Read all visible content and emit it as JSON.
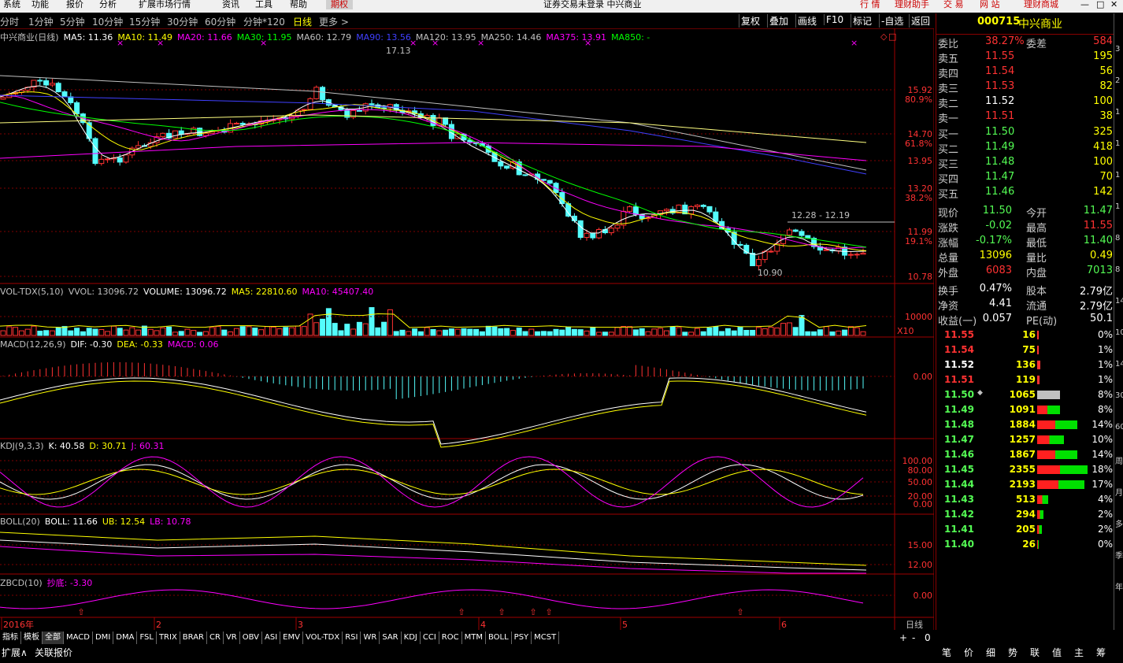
{
  "menubar": {
    "items": [
      "系统",
      "功能",
      "报价",
      "分析",
      "扩展市场行情",
      "资讯",
      "工具",
      "帮助"
    ],
    "active_tab": "期权",
    "title": "证券交易未登录  中兴商业",
    "right_buttons": [
      "行 情",
      "理财助手",
      "交 易",
      "网 站",
      "理财商城"
    ]
  },
  "periods": {
    "items": [
      "分时",
      "1分钟",
      "5分钟",
      "10分钟",
      "15分钟",
      "30分钟",
      "60分钟",
      "分钟*120",
      "日线",
      "更多 >"
    ],
    "active": "日线"
  },
  "toolbar": {
    "items": [
      "复权",
      "叠加",
      "画线",
      "F10",
      "标记",
      "-自选",
      "返回"
    ]
  },
  "main_legend": [
    {
      "text": "中兴商业(日线)",
      "color": "#c0c0c0"
    },
    {
      "text": "MA5: 11.36",
      "color": "#ffffff"
    },
    {
      "text": "MA10: 11.49",
      "color": "#ffff00"
    },
    {
      "text": "MA20: 11.66",
      "color": "#ff00ff"
    },
    {
      "text": "MA30: 11.95",
      "color": "#00ff00"
    },
    {
      "text": "MA60: 12.79",
      "color": "#c0c0c0"
    },
    {
      "text": "MA90: 13.56",
      "color": "#4040ff"
    },
    {
      "text": "MA120: 13.95",
      "color": "#c0c0c0"
    },
    {
      "text": "MA250: 14.46",
      "color": "#c0c0c0"
    },
    {
      "text": "MA375: 13.91",
      "color": "#ff00ff"
    },
    {
      "text": "MA850: -",
      "color": "#00ff00"
    }
  ],
  "price_axis": [
    {
      "v": "15.92",
      "p": "80.9%"
    },
    {
      "v": "14.70",
      "p": "61.8%"
    },
    {
      "v": "13.95",
      "p": ""
    },
    {
      "v": "13.20",
      "p": "38.2%"
    },
    {
      "v": "11.99",
      "p": "19.1%"
    },
    {
      "v": "10.78",
      "p": ""
    }
  ],
  "annotations": {
    "high": "17.13",
    "low": "10.90",
    "range": "12.28 - 12.19"
  },
  "vol_legend": [
    {
      "text": "VOL-TDX(5,10)",
      "color": "#c0c0c0"
    },
    {
      "text": "VVOL: 13096.72",
      "color": "#c0c0c0"
    },
    {
      "text": "VOLUME: 13096.72",
      "color": "#ffffff"
    },
    {
      "text": "MA5: 22810.60",
      "color": "#ffff00"
    },
    {
      "text": "MA10: 45407.40",
      "color": "#ff00ff"
    }
  ],
  "vol_axis": [
    "10000",
    "X10"
  ],
  "macd_legend": [
    {
      "text": "MACD(12,26,9)",
      "color": "#c0c0c0"
    },
    {
      "text": "DIF: -0.30",
      "color": "#ffffff"
    },
    {
      "text": "DEA: -0.33",
      "color": "#ffff00"
    },
    {
      "text": "MACD: 0.06",
      "color": "#ff00ff"
    }
  ],
  "macd_axis": [
    "0.00"
  ],
  "kdj_legend": [
    {
      "text": "KDJ(9,3,3)",
      "color": "#c0c0c0"
    },
    {
      "text": "K: 40.58",
      "color": "#ffffff"
    },
    {
      "text": "D: 30.71",
      "color": "#ffff00"
    },
    {
      "text": "J: 60.31",
      "color": "#ff00ff"
    }
  ],
  "kdj_axis": [
    "100.00",
    "80.00",
    "50.00",
    "20.00",
    "0.00"
  ],
  "boll_legend": [
    {
      "text": "BOLL(20)",
      "color": "#c0c0c0"
    },
    {
      "text": "BOLL: 11.66",
      "color": "#ffffff"
    },
    {
      "text": "UB: 12.54",
      "color": "#ffff00"
    },
    {
      "text": "LB: 10.78",
      "color": "#ff00ff"
    }
  ],
  "boll_axis": [
    "15.00",
    "12.00"
  ],
  "zbcd_legend": [
    {
      "text": "ZBCD(10)",
      "color": "#c0c0c0"
    },
    {
      "text": "抄底: -3.30",
      "color": "#ff00ff"
    }
  ],
  "zbcd_axis": [
    "0.00"
  ],
  "date_axis": [
    "2016年",
    "2",
    "3",
    "4",
    "5",
    "6"
  ],
  "date_right": "日线",
  "quote": {
    "code": "000715",
    "name": "中兴商业",
    "weibi_label": "委比",
    "weibi": "38.27%",
    "weicha_label": "委差",
    "weicha": "584",
    "asks": [
      {
        "label": "卖五",
        "price": "11.55",
        "vol": "195"
      },
      {
        "label": "卖四",
        "price": "11.54",
        "vol": "56"
      },
      {
        "label": "卖三",
        "price": "11.53",
        "vol": "82"
      },
      {
        "label": "卖二",
        "price": "11.52",
        "vol": "100"
      },
      {
        "label": "卖一",
        "price": "11.51",
        "vol": "38"
      }
    ],
    "bids": [
      {
        "label": "买一",
        "price": "11.50",
        "vol": "325"
      },
      {
        "label": "买二",
        "price": "11.49",
        "vol": "418"
      },
      {
        "label": "买三",
        "price": "11.48",
        "vol": "100"
      },
      {
        "label": "买四",
        "price": "11.47",
        "vol": "70"
      },
      {
        "label": "买五",
        "price": "11.46",
        "vol": "142"
      }
    ],
    "stats": [
      {
        "l1": "现价",
        "v1": "11.50",
        "l2": "今开",
        "v2": "11.47"
      },
      {
        "l1": "涨跌",
        "v1": "-0.02",
        "l2": "最高",
        "v2": "11.55"
      },
      {
        "l1": "涨幅",
        "v1": "-0.17%",
        "l2": "最低",
        "v2": "11.40"
      },
      {
        "l1": "总量",
        "v1": "13096",
        "l2": "量比",
        "v2": "0.49"
      },
      {
        "l1": "外盘",
        "v1": "6083",
        "l2": "内盘",
        "v2": "7013"
      },
      {
        "l1": "换手",
        "v1": "0.47%",
        "l2": "股本",
        "v2": "2.79亿"
      },
      {
        "l1": "净资",
        "v1": "4.41",
        "l2": "流通",
        "v2": "2.79亿"
      },
      {
        "l1": "收益(一)",
        "v1": "0.057",
        "l2": "PE(动)",
        "v2": "50.1"
      }
    ],
    "book": [
      {
        "price": "11.55",
        "vol": "16",
        "pct": "0%",
        "frac": 0.0
      },
      {
        "price": "11.54",
        "vol": "75",
        "pct": "1%",
        "frac": 0.03
      },
      {
        "price": "11.52",
        "vol": "136",
        "pct": "1%",
        "frac": 0.06
      },
      {
        "price": "11.51",
        "vol": "119",
        "pct": "1%",
        "frac": 0.05
      },
      {
        "price": "11.50",
        "vol": "1065",
        "pct": "8%",
        "frac": 0.45,
        "mark": "◆"
      },
      {
        "price": "11.49",
        "vol": "1091",
        "pct": "8%",
        "frac": 0.46
      },
      {
        "price": "11.48",
        "vol": "1884",
        "pct": "14%",
        "frac": 0.8
      },
      {
        "price": "11.47",
        "vol": "1257",
        "pct": "10%",
        "frac": 0.53
      },
      {
        "price": "11.46",
        "vol": "1867",
        "pct": "14%",
        "frac": 0.79
      },
      {
        "price": "11.45",
        "vol": "2355",
        "pct": "18%",
        "frac": 1.0
      },
      {
        "price": "11.44",
        "vol": "2193",
        "pct": "17%",
        "frac": 0.93
      },
      {
        "price": "11.43",
        "vol": "513",
        "pct": "4%",
        "frac": 0.22
      },
      {
        "price": "11.42",
        "vol": "294",
        "pct": "2%",
        "frac": 0.12
      },
      {
        "price": "11.41",
        "vol": "205",
        "pct": "2%",
        "frac": 0.09
      },
      {
        "price": "11.40",
        "vol": "26",
        "pct": "0%",
        "frac": 0.01
      }
    ]
  },
  "right_strip": [
    "3",
    "2",
    "1",
    "1",
    "1",
    "1",
    "8",
    "8",
    "14",
    "10",
    "14",
    "30",
    "60",
    "周",
    "月",
    "多",
    "季",
    "年"
  ],
  "indicator_tabs": [
    "指标",
    "模板",
    "全部",
    "MACD",
    "DMI",
    "DMA",
    "FSL",
    "TRIX",
    "BRAR",
    "CR",
    "VR",
    "OBV",
    "ASI",
    "EMV",
    "VOL-TDX",
    "RSI",
    "WR",
    "SAR",
    "KDJ",
    "CCI",
    "ROC",
    "MTM",
    "BOLL",
    "PSY",
    "MCST"
  ],
  "bottom_left": [
    "扩展∧",
    "关联报价"
  ],
  "bottom_right_tabs": [
    "笔",
    "价",
    "细",
    "势",
    "联",
    "值",
    "主",
    "筹"
  ],
  "scroll_controls": [
    "+",
    "-",
    "0"
  ],
  "colors": {
    "up": "#ff3232",
    "down": "#54fcfc",
    "grid": "#800000",
    "bg": "#000000",
    "axis": "#c00000"
  }
}
